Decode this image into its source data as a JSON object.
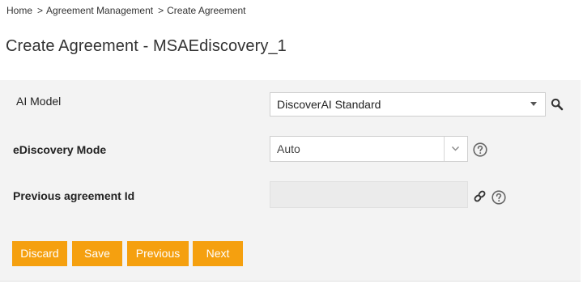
{
  "breadcrumb": {
    "home": "Home",
    "separator": ">",
    "agreement_management": "Agreement Management",
    "create_agreement": "Create Agreement"
  },
  "page": {
    "title": "Create Agreement - MSAEdiscovery_1"
  },
  "form": {
    "ai_model": {
      "label": "AI Model",
      "value": "DiscoverAI Standard"
    },
    "ediscovery_mode": {
      "label": "eDiscovery Mode",
      "value": "Auto"
    },
    "previous_agreement_id": {
      "label": "Previous agreement Id",
      "value": ""
    }
  },
  "buttons": {
    "discard": "Discard",
    "save": "Save",
    "previous": "Previous",
    "next": "Next"
  },
  "colors": {
    "accent": "#f5a00f",
    "panel_bg": "#f3f3f3",
    "help_icon": "#666666"
  }
}
